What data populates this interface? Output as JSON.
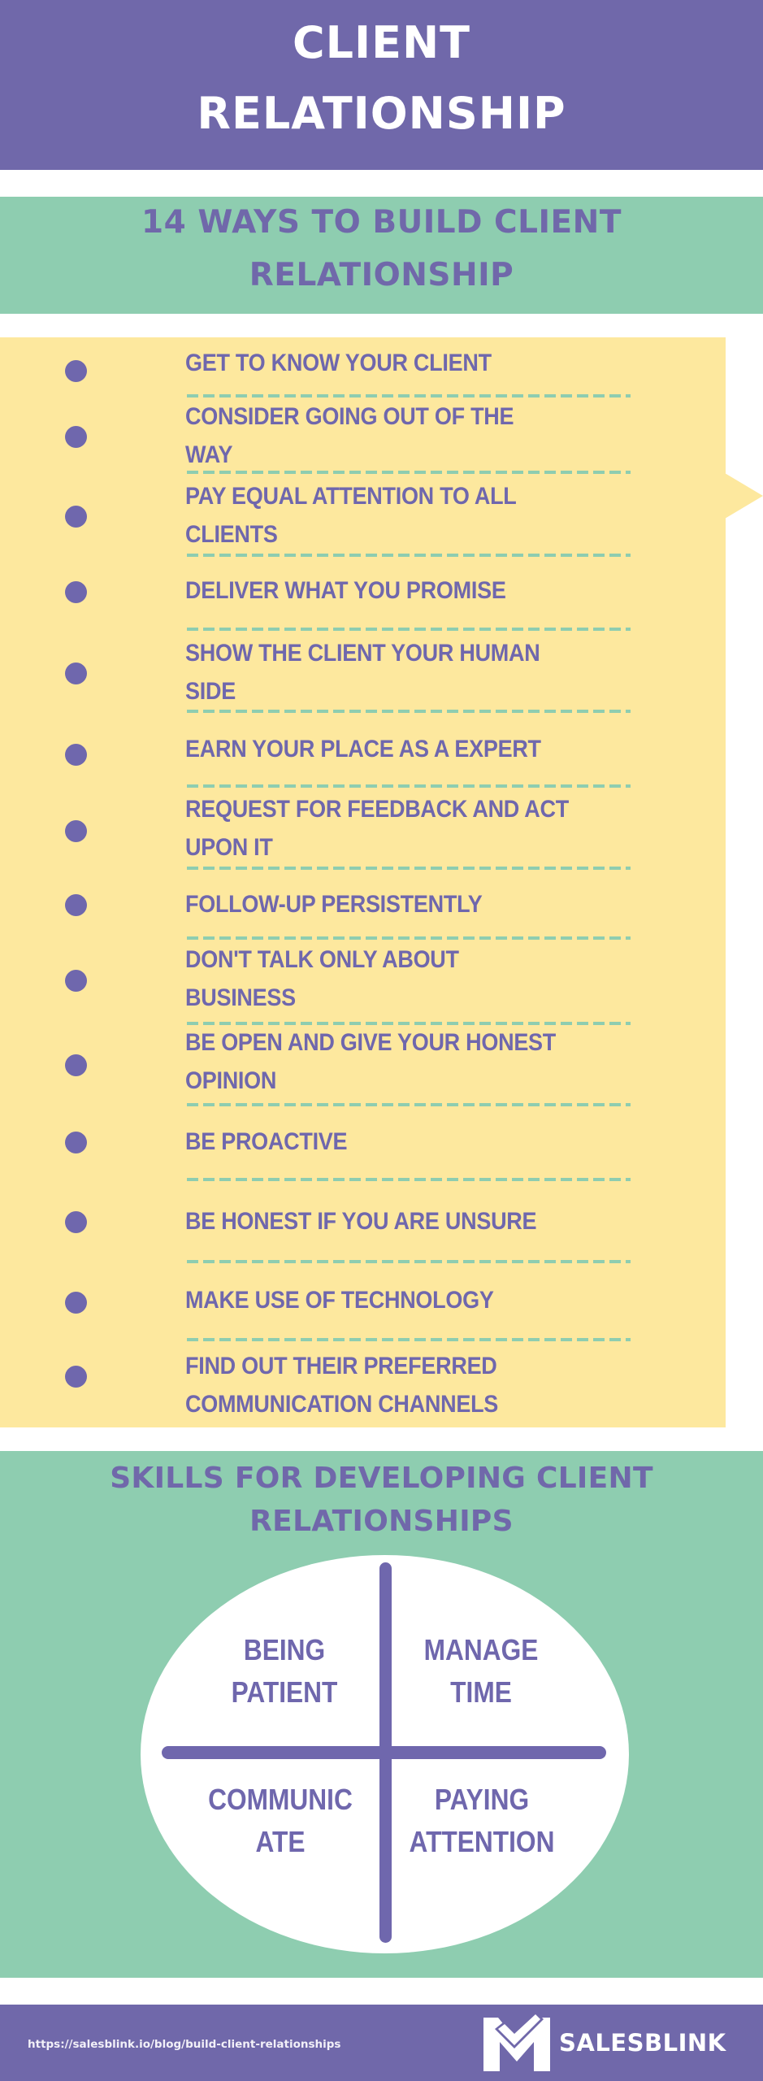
{
  "header": {
    "title_lines": [
      "CLIENT",
      "RELATIONSHIP"
    ]
  },
  "ways_section": {
    "title_lines": [
      "14 WAYS TO BUILD CLIENT",
      "RELATIONSHIP"
    ],
    "items": [
      {
        "lines": [
          "GET TO KNOW YOUR CLIENT"
        ]
      },
      {
        "lines": [
          "CONSIDER GOING OUT OF THE",
          "WAY"
        ]
      },
      {
        "lines": [
          "PAY EQUAL ATTENTION TO ALL",
          "CLIENTS"
        ]
      },
      {
        "lines": [
          "DELIVER WHAT YOU PROMISE"
        ]
      },
      {
        "lines": [
          "SHOW THE CLIENT YOUR HUMAN",
          "SIDE"
        ]
      },
      {
        "lines": [
          "EARN YOUR PLACE AS A EXPERT"
        ]
      },
      {
        "lines": [
          "REQUEST FOR FEEDBACK AND ACT",
          "UPON IT"
        ]
      },
      {
        "lines": [
          "FOLLOW-UP PERSISTENTLY"
        ]
      },
      {
        "lines": [
          "DON'T TALK ONLY ABOUT",
          "BUSINESS"
        ]
      },
      {
        "lines": [
          "BE OPEN AND GIVE YOUR HONEST",
          "OPINION"
        ]
      },
      {
        "lines": [
          "BE PROACTIVE"
        ]
      },
      {
        "lines": [
          "BE HONEST IF YOU ARE UNSURE"
        ]
      },
      {
        "lines": [
          "MAKE USE OF TECHNOLOGY"
        ]
      },
      {
        "lines": [
          "FIND OUT THEIR PREFERRED",
          "COMMUNICATION CHANNELS"
        ]
      }
    ]
  },
  "skills_section": {
    "title_lines": [
      "SKILLS FOR DEVELOPING CLIENT",
      "RELATIONSHIPS"
    ],
    "quadrants": {
      "top_left": [
        "BEING",
        "PATIENT"
      ],
      "top_right": [
        "MANAGE",
        "TIME"
      ],
      "bottom_left": [
        "COMMUNIC",
        "ATE"
      ],
      "bottom_right": [
        "PAYING",
        "ATTENTION"
      ]
    }
  },
  "footer": {
    "url": "https://salesblink.io/blog/build-client-relationships",
    "brand": "SALESBLINK",
    "logo_icon": "salesblink-logo-icon"
  },
  "colors": {
    "purple": "#7068aa",
    "green": "#8ecdb0",
    "yellow": "#fde89e",
    "white": "#ffffff"
  }
}
